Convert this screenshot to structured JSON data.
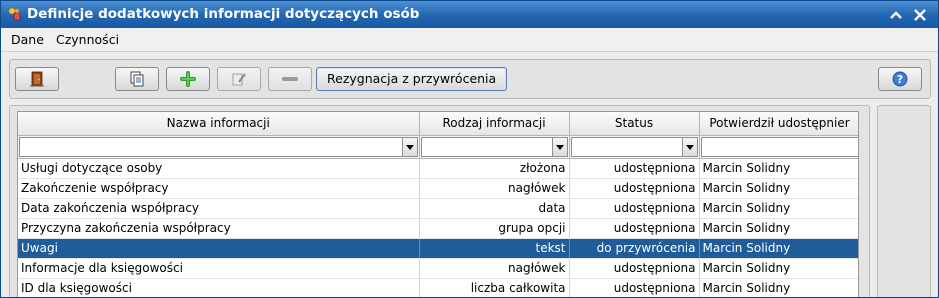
{
  "window": {
    "title": "Definicje dodatkowych informacji dotyczących osób",
    "icon": "app-icon",
    "colors": {
      "titlebar": "#2266b1",
      "selection": "#1f5c99"
    }
  },
  "menubar": {
    "items": [
      {
        "label": "Dane"
      },
      {
        "label": "Czynności"
      }
    ]
  },
  "toolbar": {
    "exit_icon": "door-exit-icon",
    "copy_icon": "copy-document-icon",
    "add_icon": "plus-icon",
    "edit_icon": "edit-pencil-icon",
    "delete_icon": "minus-icon",
    "resign_label": "Rezygnacja z przywrócenia",
    "help_icon": "help-icon"
  },
  "grid": {
    "columns": [
      {
        "label": "Nazwa informacji"
      },
      {
        "label": "Rodzaj informacji"
      },
      {
        "label": "Status"
      },
      {
        "label": "Potwierdził udostępnier"
      }
    ],
    "rows": [
      {
        "name": "Usługi dotyczące osoby",
        "type": "złożona",
        "status": "udostępniona",
        "confirmed_by": "Marcin Solidny",
        "selected": false
      },
      {
        "name": "Zakończenie współpracy",
        "type": "nagłówek",
        "status": "udostępniona",
        "confirmed_by": "Marcin Solidny",
        "selected": false
      },
      {
        "name": "Data zakończenia współpracy",
        "type": "data",
        "status": "udostępniona",
        "confirmed_by": "Marcin Solidny",
        "selected": false
      },
      {
        "name": "Przyczyna zakończenia współpracy",
        "type": "grupa opcji",
        "status": "udostępniona",
        "confirmed_by": "Marcin Solidny",
        "selected": false
      },
      {
        "name": "Uwagi",
        "type": "tekst",
        "status": "do przywrócenia",
        "confirmed_by": "Marcin Solidny",
        "selected": true
      },
      {
        "name": "Informacje dla księgowości",
        "type": "nagłówek",
        "status": "udostępniona",
        "confirmed_by": "Marcin Solidny",
        "selected": false
      },
      {
        "name": "ID dla księgowości",
        "type": "liczba całkowita",
        "status": "udostępniona",
        "confirmed_by": "Marcin Solidny",
        "selected": false
      }
    ]
  }
}
